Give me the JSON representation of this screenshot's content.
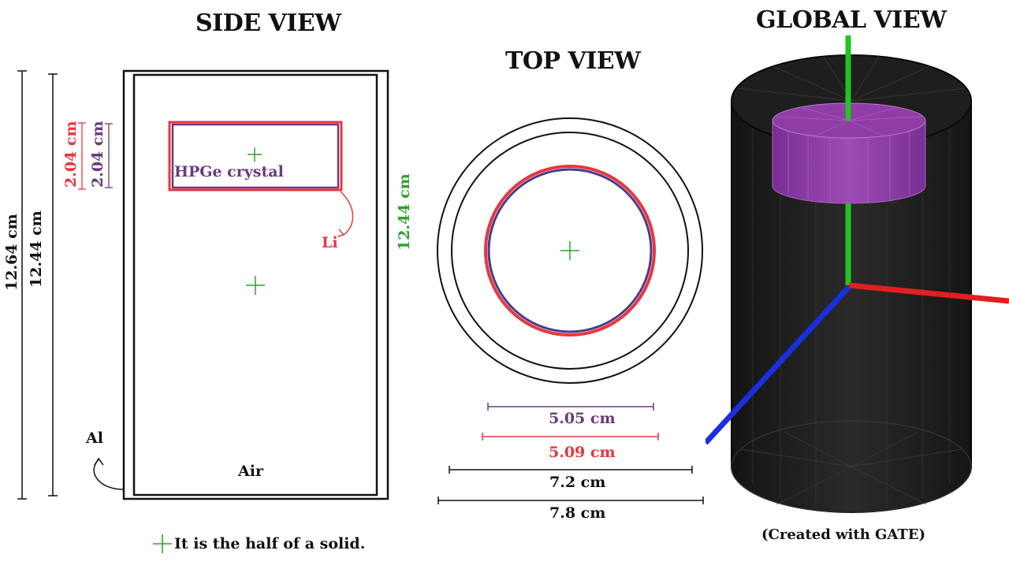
{
  "titles": {
    "side": "SIDE VIEW",
    "top": "TOP VIEW",
    "global": "GLOBAL VIEW"
  },
  "side_view": {
    "outer_height": "12.64 cm",
    "inner_height": "12.44 cm",
    "crystal_height_li": "2.04 cm",
    "crystal_height": "2.04 cm",
    "crystal_label": "HPGe crystal",
    "li_label": "Li",
    "al_label": "Al",
    "air_label": "Air"
  },
  "top_view": {
    "height_label": "12.44 cm",
    "dim_crystal": "5.05 cm",
    "dim_li": "5.09 cm",
    "dim_inner": "7.2 cm",
    "dim_outer": "7.8 cm"
  },
  "footnote": "It is the half of a solid.",
  "global_caption": "(Created with GATE)",
  "colors": {
    "black": "#111111",
    "li_red": "#e8373d",
    "crystal_purple": "#6a3a7e",
    "center_green": "#2fa32f",
    "axis_green": "#22c322",
    "axis_red": "#e02020",
    "axis_blue": "#1a2fe0",
    "cylinder_dark": "#1c1c1c",
    "crystal_fill": "#8a3aa0"
  }
}
